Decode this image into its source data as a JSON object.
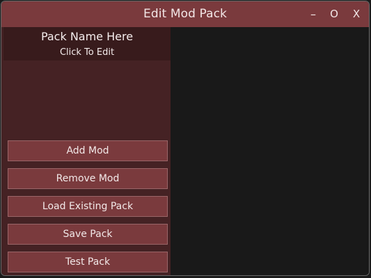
{
  "window": {
    "title": "Edit Mod Pack",
    "controls": {
      "minimize": "–",
      "maximize": "O",
      "close": "X"
    }
  },
  "pack": {
    "name": "Pack Name Here",
    "hint": "Click To Edit"
  },
  "buttons": {
    "add_mod": "Add Mod",
    "remove_mod": "Remove Mod",
    "load_existing": "Load Existing Pack",
    "save_pack": "Save Pack",
    "test_pack": "Test Pack"
  },
  "colors": {
    "accent": "#7a3a3d",
    "sidebar": "#452224",
    "name_panel": "#381b1c",
    "content": "#191919"
  }
}
